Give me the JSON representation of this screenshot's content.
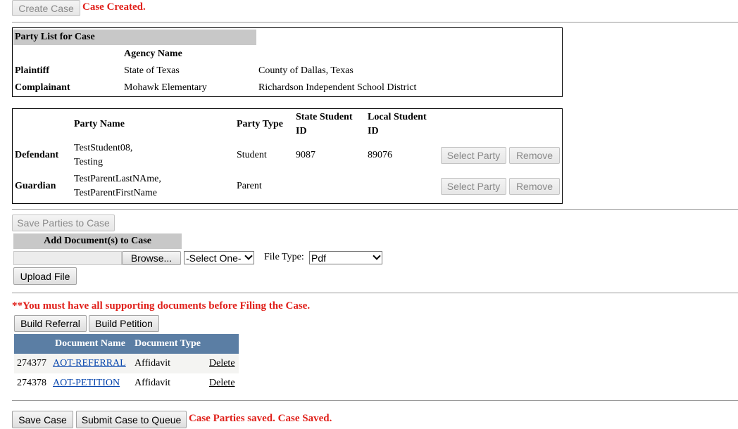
{
  "top": {
    "create_case_label": "Create Case",
    "case_created_msg": "Case Created."
  },
  "party_list": {
    "title": "Party List for Case",
    "agency_header": "Agency Name",
    "rows": [
      {
        "role": "Plaintiff",
        "agency": "State of Texas",
        "entity": "County of Dallas, Texas"
      },
      {
        "role": "Complainant",
        "agency": "Mohawk Elementary",
        "entity": "Richardson Independent School District"
      }
    ]
  },
  "parties": {
    "headers": {
      "party_name": "Party Name",
      "party_type": "Party Type",
      "state_id_1": "State Student",
      "state_id_2": "ID",
      "local_id_1": "Local Student",
      "local_id_2": "ID"
    },
    "rows": [
      {
        "role": "Defendant",
        "name_1": "TestStudent08,",
        "name_2": "Testing",
        "type": "Student",
        "state_id": "9087",
        "local_id": "89076",
        "select_label": "Select Party",
        "remove_label": "Remove"
      },
      {
        "role": "Guardian",
        "name_1": "TestParentLastNAme,",
        "name_2": "TestParentFirstName",
        "type": "Parent",
        "state_id": "",
        "local_id": "",
        "select_label": "Select Party",
        "remove_label": "Remove"
      }
    ]
  },
  "save_parties_label": "Save Parties to Case",
  "documents_upload": {
    "header": "Add Document(s) to Case",
    "file_value": "",
    "browse_label": "Browse...",
    "category_selected": "-Select One-",
    "file_type_label": "File Type:",
    "file_type_selected": "Pdf",
    "upload_label": "Upload File"
  },
  "warning": "**You must have all supporting documents before Filing the Case.",
  "build": {
    "referral_label": "Build Referral",
    "petition_label": "Build Petition"
  },
  "doc_table": {
    "headers": {
      "name": "Document Name",
      "type": "Document Type"
    },
    "rows": [
      {
        "id": "274377",
        "name": "AOT-REFERRAL",
        "type": "Affidavit",
        "delete_label": "Delete"
      },
      {
        "id": "274378",
        "name": "AOT-PETITION",
        "type": "Affidavit",
        "delete_label": "Delete"
      }
    ],
    "header_color": "#5b7ea4"
  },
  "bottom": {
    "save_case_label": "Save Case",
    "submit_label": "Submit Case to Queue",
    "status_msg": "Case Parties saved. Case Saved."
  }
}
